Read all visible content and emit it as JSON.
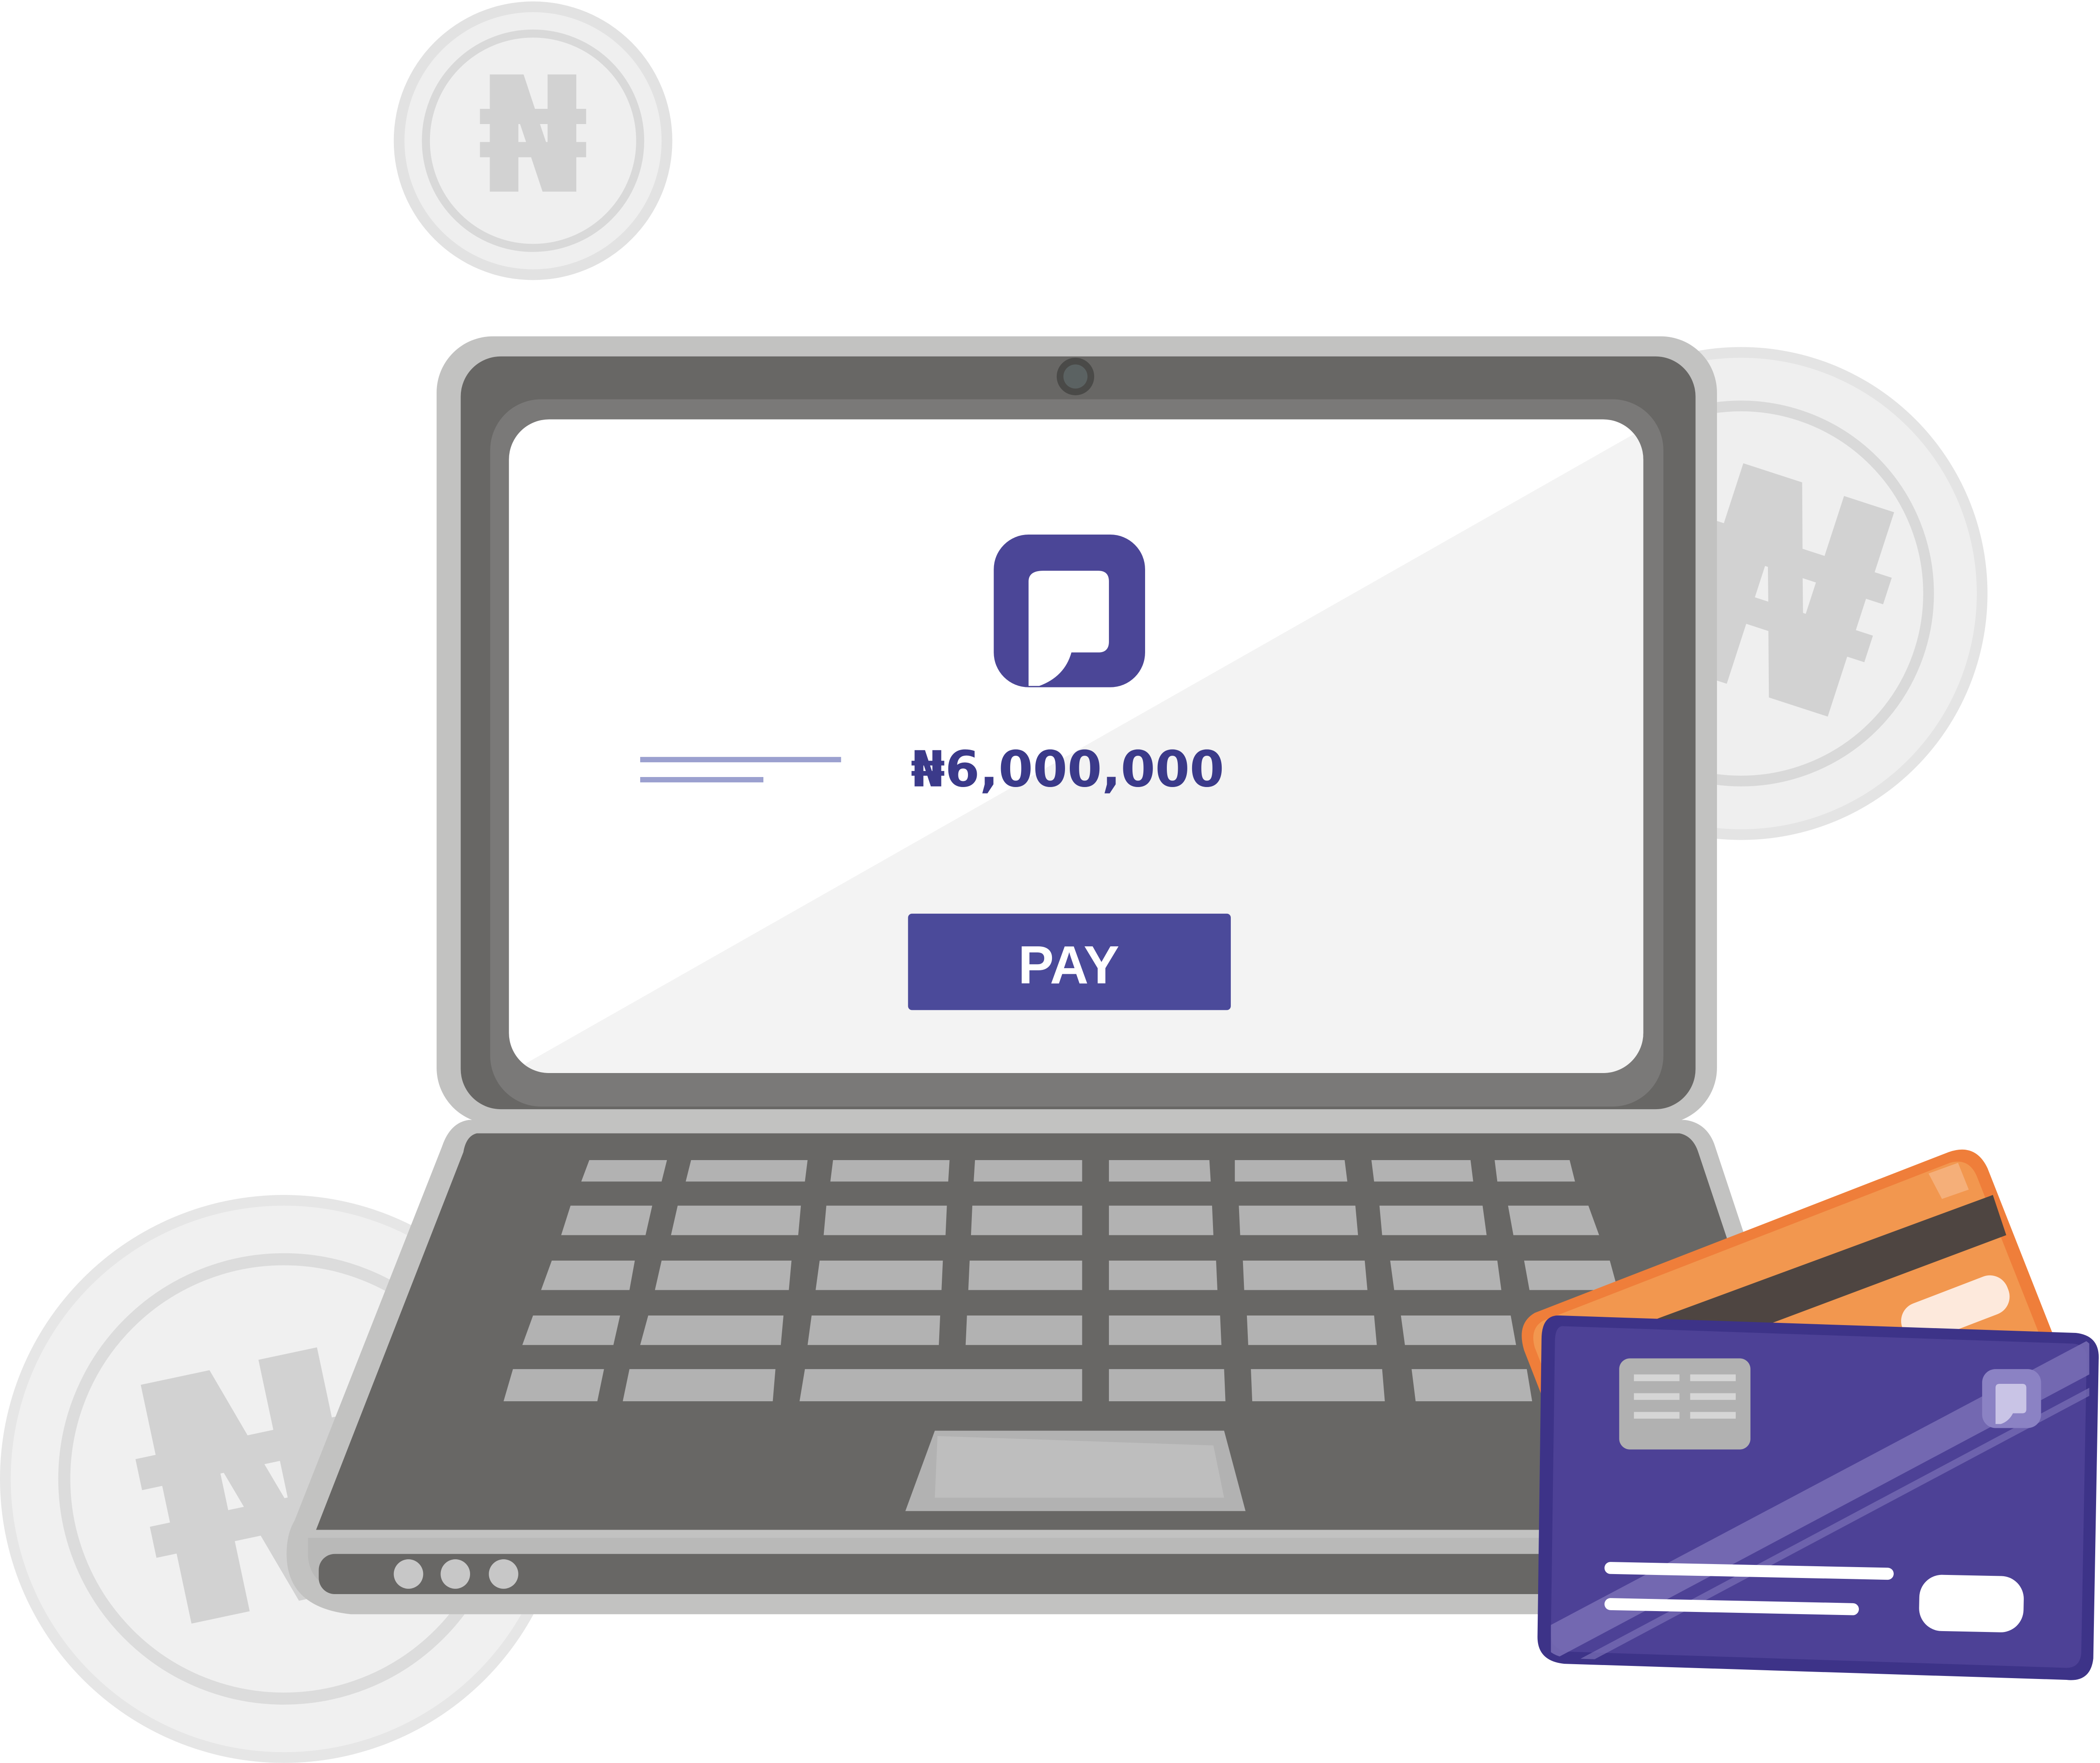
{
  "currency_symbol": "₦",
  "payment": {
    "amount": "₦6,000,000",
    "pay_label": "PAY"
  },
  "colors": {
    "brand_purple": "#4b4697",
    "card_orange": "#f0904a",
    "laptop_dark": "#686765",
    "laptop_frame": "#c2c2c1",
    "screen": "#f3f3f3",
    "coin": "#efefef",
    "key": "#b2b2b2"
  },
  "icons": [
    "brand-logo-icon",
    "naira-coin",
    "credit-card",
    "webcam",
    "touchpad"
  ]
}
